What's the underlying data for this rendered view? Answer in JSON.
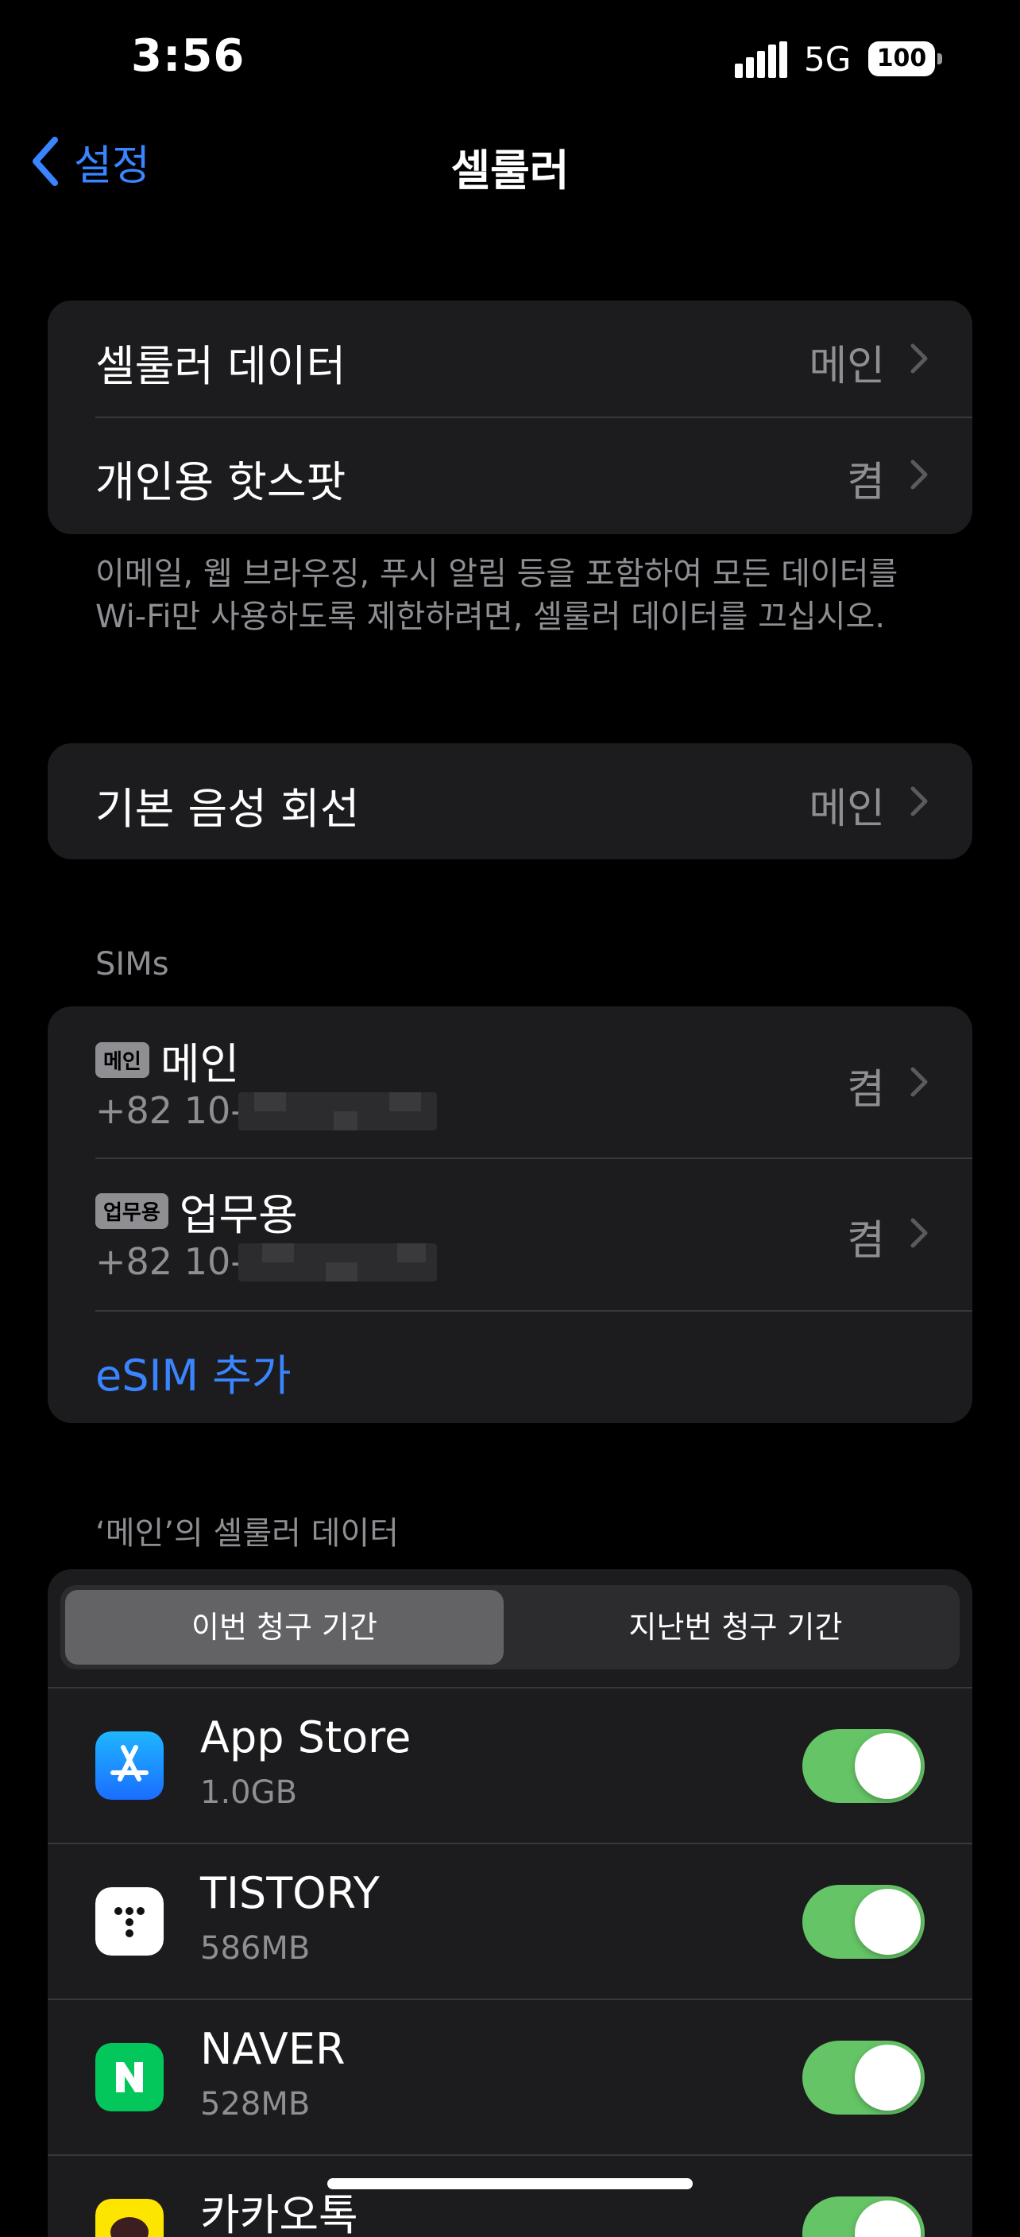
{
  "status": {
    "time": "3:56",
    "network": "5G",
    "battery": "100"
  },
  "nav": {
    "back_label": "설정",
    "title": "셀룰러"
  },
  "group1": {
    "items": [
      {
        "label": "셀룰러 데이터",
        "value": "메인"
      },
      {
        "label": "개인용 핫스팟",
        "value": "켬"
      }
    ]
  },
  "footer1": "이메일, 웹 브라우징, 푸시 알림 등을 포함하여 모든 데이터를 Wi-Fi만 사용하도록 제한하려면, 셀룰러 데이터를 끄십시오.",
  "group2": {
    "label": "기본 음성 회선",
    "value": "메인"
  },
  "sims": {
    "header": "SIMs",
    "items": [
      {
        "badge": "메인",
        "name": "메인",
        "number": "+82 10-",
        "value": "켬"
      },
      {
        "badge": "업무용",
        "name": "업무용",
        "number": "+82 10-",
        "value": "켬"
      }
    ],
    "add_label": "eSIM 추가"
  },
  "data_section": {
    "header": "‘메인’의 셀룰러 데이터",
    "segments": [
      "이번 청구 기간",
      "지난번 청구 기간"
    ],
    "selected_segment": "이번 청구 기간",
    "apps": [
      {
        "name": "App Store",
        "size": "1.0GB",
        "enabled": true,
        "icon": "app-store-icon"
      },
      {
        "name": "TISTORY",
        "size": "586MB",
        "enabled": true,
        "icon": "tistory-icon"
      },
      {
        "name": "NAVER",
        "size": "528MB",
        "enabled": true,
        "icon": "naver-icon"
      },
      {
        "name": "카카오톡",
        "size": "",
        "enabled": true,
        "icon": "kakaotalk-icon"
      }
    ]
  },
  "colors": {
    "accent": "#3a85ff",
    "toggle_on": "#65c466",
    "cell_bg": "#1c1c1e"
  }
}
